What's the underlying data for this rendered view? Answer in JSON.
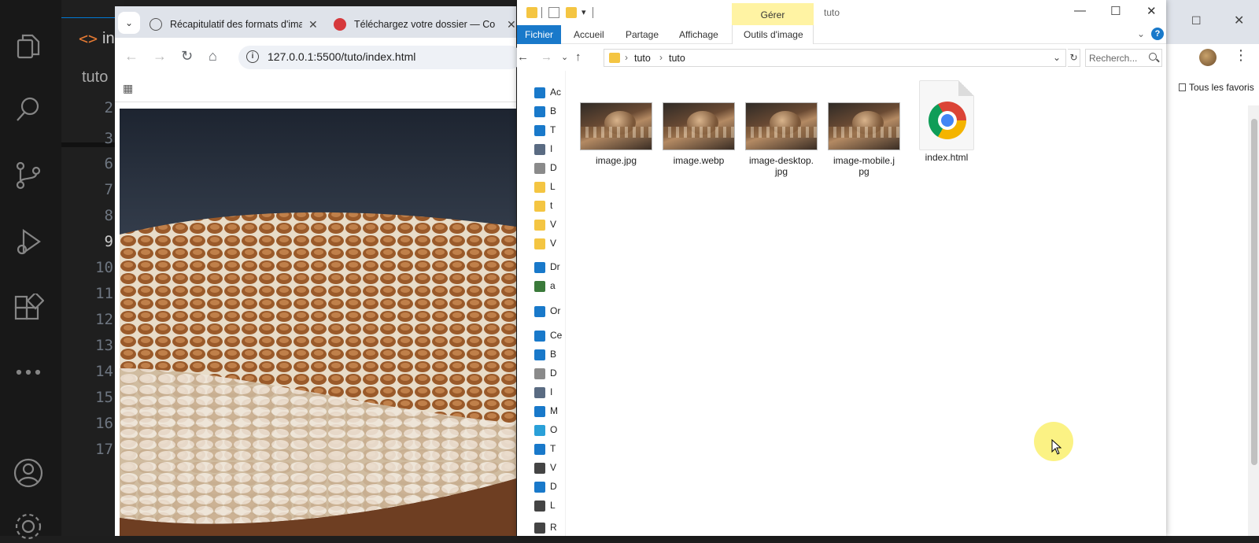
{
  "vscode": {
    "tab_label": "in",
    "breadcrumb": "tuto",
    "line_numbers": [
      "2",
      "3",
      "6",
      "7",
      "8",
      "9",
      "10",
      "11",
      "12",
      "13",
      "14",
      "15",
      "16",
      "17"
    ],
    "current_line": "9"
  },
  "browser": {
    "tabs": [
      {
        "label": "Récapitulatif des formats d'image"
      },
      {
        "label": "Téléchargez votre dossier — Co"
      }
    ],
    "url": "127.0.0.1:5500/tuto/index.html"
  },
  "background_chrome": {
    "bookmark_label": "Tous les favoris"
  },
  "explorer": {
    "title": "tuto",
    "contextual_group": "Gérer",
    "ribbon_tabs": [
      "Fichier",
      "Accueil",
      "Partage",
      "Affichage",
      "Outils d'image"
    ],
    "breadcrumb": [
      "tuto",
      "tuto"
    ],
    "search_placeholder": "Recherch...",
    "nav_items": [
      "Ac",
      "B",
      "T",
      "I",
      "D",
      "L",
      "t",
      "V",
      "V",
      "Dr",
      "a",
      "Or",
      "Ce",
      "B",
      "D",
      "I",
      "M",
      "O",
      "T",
      "V",
      "D",
      "L",
      "R"
    ],
    "files": [
      {
        "name": "image.jpg",
        "type": "image"
      },
      {
        "name": "image.webp",
        "type": "image"
      },
      {
        "name": "image-desktop.jpg",
        "type": "image"
      },
      {
        "name": "image-mobile.jpg",
        "type": "image"
      },
      {
        "name": "index.html",
        "type": "html"
      }
    ]
  }
}
